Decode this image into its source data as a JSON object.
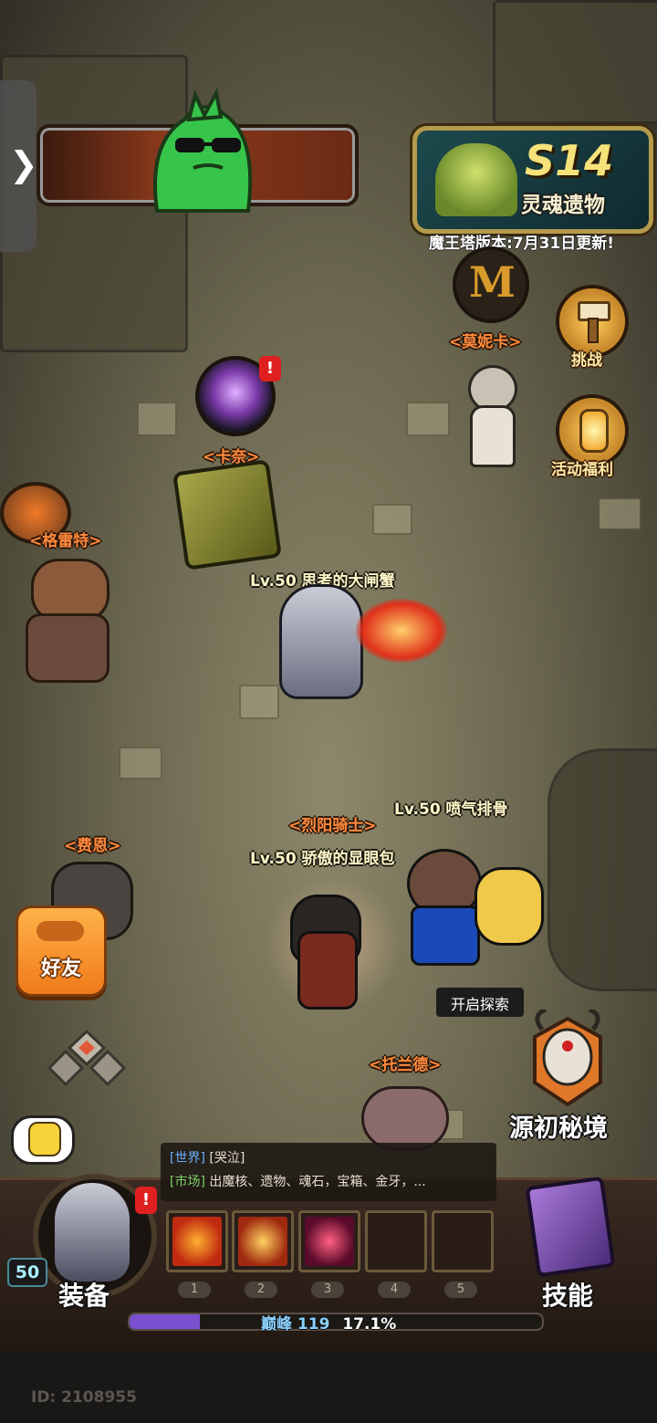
{
  "season": {
    "code": "S14",
    "name": "灵魂遗物"
  },
  "version_notice": "魔王塔版本:7月31日更新!",
  "side_buttons": {
    "challenge": "挑战",
    "event_welfare": "活动福利"
  },
  "npcs": {
    "monica": "<莫妮卡>",
    "kanai": "<卡奈>",
    "gerrit": "<格雷特>",
    "fein": "<费恩>",
    "sun_knight": "<烈阳骑士>",
    "tolande": "<托兰德>"
  },
  "players": {
    "crab": "Lv.50 思考的大闸蟹",
    "ribs": "Lv.50 喷气排骨",
    "bun": "Lv.50 骄傲的显眼包"
  },
  "friends_button": "好友",
  "explore_tooltip": "开启探索",
  "origin_realm": "源初秘境",
  "chat": {
    "line1": {
      "channel": "[世界]",
      "text": " [哭泣]"
    },
    "line2": {
      "channel": "[市场]",
      "text": " 出魔核、遗物、魂石，宝箱、金牙，..."
    }
  },
  "skill_slots": [
    "1",
    "2",
    "3",
    "4",
    "5"
  ],
  "player_level": "50",
  "equip_label": "装备",
  "skills_label": "技能",
  "peak": {
    "label": "巅峰",
    "level": "119",
    "percent": "17.1%",
    "progress": 0.171
  },
  "user_id": "ID: 2108955",
  "colors": {
    "npc_label": "#ff8a3d",
    "accent_gold": "#ffe9a8",
    "xp_fill": "#7a4fd0"
  }
}
